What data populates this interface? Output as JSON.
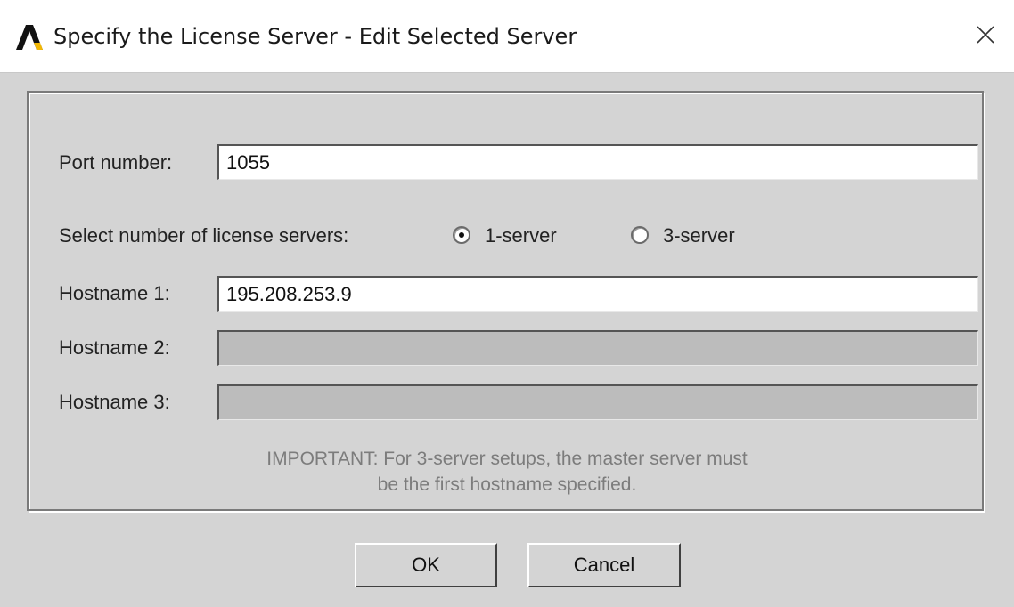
{
  "window": {
    "title": "Specify the License Server - Edit Selected Server",
    "icon": "ansys-logo-icon",
    "close_icon": "close-icon"
  },
  "form": {
    "port": {
      "label": "Port number:",
      "value": "1055"
    },
    "server_count": {
      "label": "Select number of license servers:",
      "options": [
        {
          "label": "1-server",
          "selected": true
        },
        {
          "label": "3-server",
          "selected": false
        }
      ]
    },
    "hostnames": [
      {
        "label": "Hostname 1:",
        "value": "195.208.253.9",
        "enabled": true
      },
      {
        "label": "Hostname 2:",
        "value": "",
        "enabled": false
      },
      {
        "label": "Hostname 3:",
        "value": "",
        "enabled": false
      }
    ],
    "note_line1": "IMPORTANT: For 3-server setups, the master server must",
    "note_line2": "be the first hostname specified."
  },
  "buttons": {
    "ok": "OK",
    "cancel": "Cancel"
  },
  "colors": {
    "dialog_bg": "#d4d4d4",
    "titlebar_bg": "#ffffff",
    "logo_black": "#111111",
    "logo_yellow": "#f2b705",
    "disabled_field": "#bcbcbc",
    "note_text": "#7c7c7c"
  }
}
